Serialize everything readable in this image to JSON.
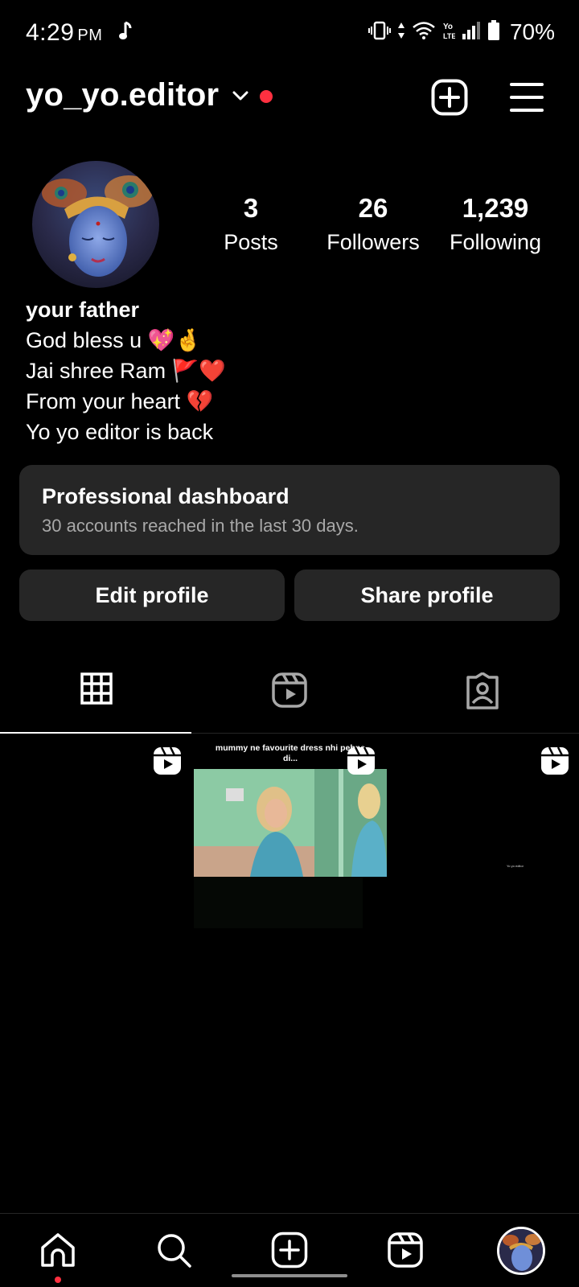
{
  "status_bar": {
    "time": "4:29",
    "ampm": "PM",
    "battery": "70%",
    "icons": [
      "music-note-icon",
      "vibrate-icon",
      "data-arrows-icon",
      "wifi-icon",
      "volte-icon",
      "signal-icon",
      "battery-icon"
    ]
  },
  "header": {
    "username": "yo_yo.editor",
    "has_notification_dot": true
  },
  "profile": {
    "stats": [
      {
        "value": "3",
        "label": "Posts"
      },
      {
        "value": "26",
        "label": "Followers"
      },
      {
        "value": "1,239",
        "label": "Following"
      }
    ],
    "bio": {
      "name": "your father",
      "lines": [
        "God bless u 💖🤞",
        "Jai shree Ram 🚩❤️",
        "From your heart 💔",
        "Yo yo editor is back"
      ]
    }
  },
  "dashboard": {
    "title": "Professional dashboard",
    "subtitle": "30 accounts reached in the last 30 days."
  },
  "actions": {
    "edit": "Edit profile",
    "share": "Share profile"
  },
  "tabs": [
    "grid-icon",
    "reels-icon",
    "tagged-icon"
  ],
  "posts": [
    {
      "type": "reel",
      "caption": ""
    },
    {
      "type": "reel",
      "caption": "mummy ne favourite dress nhi pehne di..."
    },
    {
      "type": "reel",
      "caption": "Yo yo editor"
    }
  ],
  "bottom_nav": [
    "home-icon",
    "search-icon",
    "create-icon",
    "reels-icon",
    "profile-avatar"
  ],
  "colors": {
    "background": "#000000",
    "card": "#262626",
    "secondary_text": "#a8a8a8",
    "notification": "#ff3040"
  }
}
